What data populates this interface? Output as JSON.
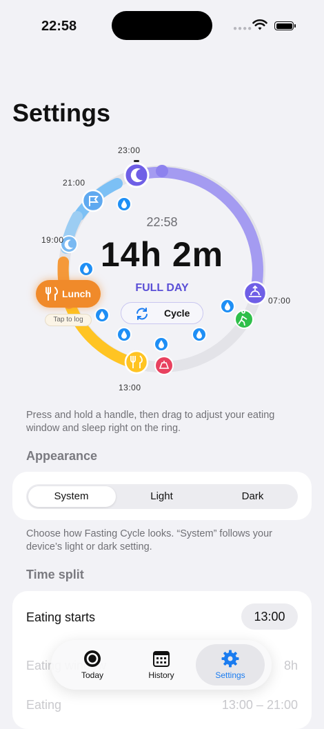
{
  "status": {
    "time": "22:58"
  },
  "page": {
    "title": "Settings"
  },
  "ring": {
    "ticks": {
      "t2300": "23:00",
      "t2100": "21:00",
      "t1900": "19:00",
      "t0700": "07:00",
      "t1300": "13:00"
    },
    "current_clock": "22:58",
    "elapsed": "14h 2m",
    "mode": "FULL DAY",
    "cycle_label": "Cycle",
    "lunch_label": "Lunch",
    "tap_to_log": "Tap to log",
    "colors": {
      "sleep": "#9a8ff0",
      "eating": "#ffc423",
      "lunch": "#f08a2a",
      "evening": "#6ab4f2",
      "water": "#1f8ff5",
      "walk": "#2fbf4a",
      "snack": "#e8415f",
      "track": "#e3e3e8"
    }
  },
  "help_ring": "Press and hold a handle, then drag to adjust your eating window and sleep right on the ring.",
  "appearance": {
    "header": "Appearance",
    "options": [
      "System",
      "Light",
      "Dark"
    ],
    "selected": "System",
    "help": "Choose how Fasting Cycle looks. “System” follows your device’s light or dark setting."
  },
  "time_split": {
    "header": "Time split",
    "rows": [
      {
        "label": "Eating starts",
        "value": "13:00"
      },
      {
        "label": "Eating window",
        "value": "8h"
      },
      {
        "label": "Eating",
        "value": "13:00 – 21:00"
      }
    ]
  },
  "tabbar": {
    "tabs": [
      {
        "label": "Today",
        "icon": "target-icon"
      },
      {
        "label": "History",
        "icon": "calendar-icon"
      },
      {
        "label": "Settings",
        "icon": "gear-icon"
      }
    ],
    "selected": "Settings",
    "accent": "#1a7cf0"
  }
}
